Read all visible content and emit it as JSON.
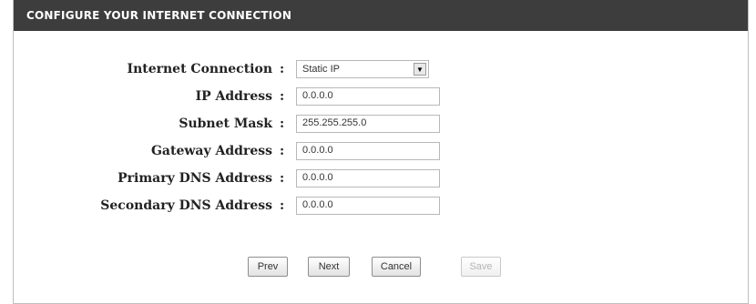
{
  "header": {
    "title": "CONFIGURE YOUR INTERNET CONNECTION"
  },
  "form": {
    "connection": {
      "label": "Internet Connection",
      "colon": ":",
      "value": "Static IP"
    },
    "ip": {
      "label": "IP Address",
      "colon": ":",
      "value": "0.0.0.0"
    },
    "subnet": {
      "label": "Subnet Mask",
      "colon": ":",
      "value": "255.255.255.0"
    },
    "gateway": {
      "label": "Gateway Address",
      "colon": ":",
      "value": "0.0.0.0"
    },
    "dns1": {
      "label": "Primary DNS Address",
      "colon": ":",
      "value": "0.0.0.0"
    },
    "dns2": {
      "label": "Secondary DNS Address",
      "colon": ":",
      "value": "0.0.0.0"
    }
  },
  "buttons": {
    "prev": "Prev",
    "next": "Next",
    "cancel": "Cancel",
    "save": "Save"
  },
  "colors": {
    "header_bg": "#3d3d3d",
    "header_text": "#ffffff"
  },
  "icons": {
    "dropdown": "chevron-down-icon"
  }
}
